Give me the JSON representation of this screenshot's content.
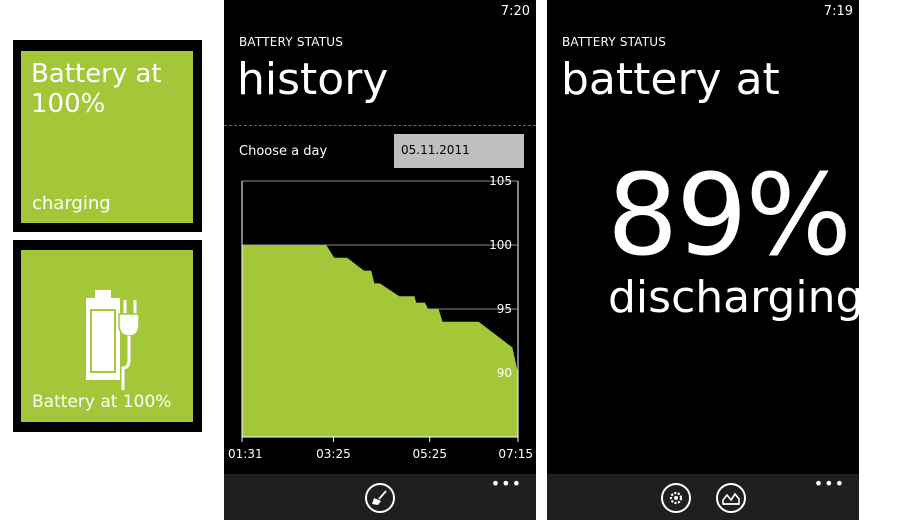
{
  "tile_large": {
    "title_line1": "Battery at",
    "title_line2": "100%",
    "status": "charging",
    "color": "#a4c639"
  },
  "tile_icon": {
    "label": "Battery at 100%",
    "icon": "battery-plug-icon",
    "color": "#a4c639"
  },
  "history_screen": {
    "clock": "7:20",
    "app_title": "BATTERY STATUS",
    "page_title": "history",
    "chooser_label": "Choose a day",
    "date_value": "05.11.2011",
    "appbar_icon": "broom-icon",
    "more_label": "•••"
  },
  "status_screen": {
    "clock": "7:19",
    "app_title": "BATTERY STATUS",
    "page_title": "battery at",
    "percent": "89%",
    "state": "discharging",
    "appbar_icons": [
      "settings-icon",
      "chart-icon"
    ],
    "more_label": "•••"
  },
  "chart_data": {
    "type": "area",
    "x_tick_labels": [
      "01:31",
      "03:25",
      "05:25",
      "07:15"
    ],
    "y_ticks": [
      90,
      95,
      100,
      105
    ],
    "ylim": [
      85,
      105
    ],
    "xlim": [
      "01:31",
      "07:15"
    ],
    "grid": true,
    "color": "#a4c639",
    "x": [
      "01:31",
      "03:16",
      "03:26",
      "03:42",
      "04:03",
      "04:12",
      "04:16",
      "04:23",
      "04:47",
      "05:06",
      "05:08",
      "05:19",
      "05:23",
      "05:36",
      "05:41",
      "06:26",
      "07:08",
      "07:15"
    ],
    "y": [
      100,
      100,
      99,
      99,
      98,
      98,
      97,
      97,
      96,
      96,
      95.5,
      95.5,
      95,
      95,
      94,
      94,
      92,
      90
    ]
  }
}
